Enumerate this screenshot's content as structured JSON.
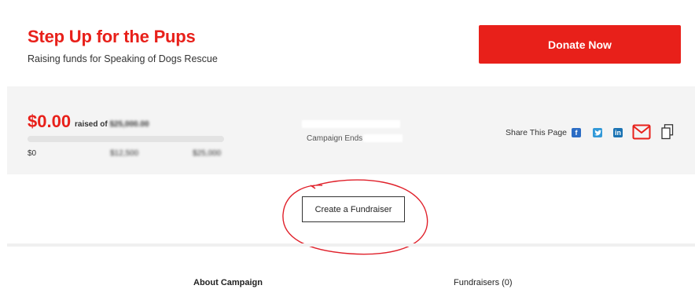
{
  "header": {
    "title": "Step Up for the Pups",
    "subtitle": "Raising funds for Speaking of Dogs Rescue",
    "donate_label": "Donate Now"
  },
  "stats": {
    "raised_amount": "$0.00",
    "raised_of_text": "raised of",
    "goal_amount": "$25,000.00",
    "progress_fraction": 0.0,
    "scale_min": "$0",
    "scale_mid": "$12,500",
    "scale_max": "$25,000",
    "campaign_ends_label": "Campaign Ends"
  },
  "share": {
    "label": "Share This Page",
    "icons": [
      "facebook-icon",
      "twitter-icon",
      "linkedin-icon",
      "email-icon",
      "copy-link-icon"
    ]
  },
  "cta": {
    "create_fundraiser_label": "Create a Fundraiser"
  },
  "tabs": {
    "about_label": "About Campaign",
    "fundraisers_label": "Fundraisers (0)"
  },
  "colors": {
    "accent": "#e8201a",
    "panel": "#f4f4f4",
    "annotation": "#e0202a"
  }
}
